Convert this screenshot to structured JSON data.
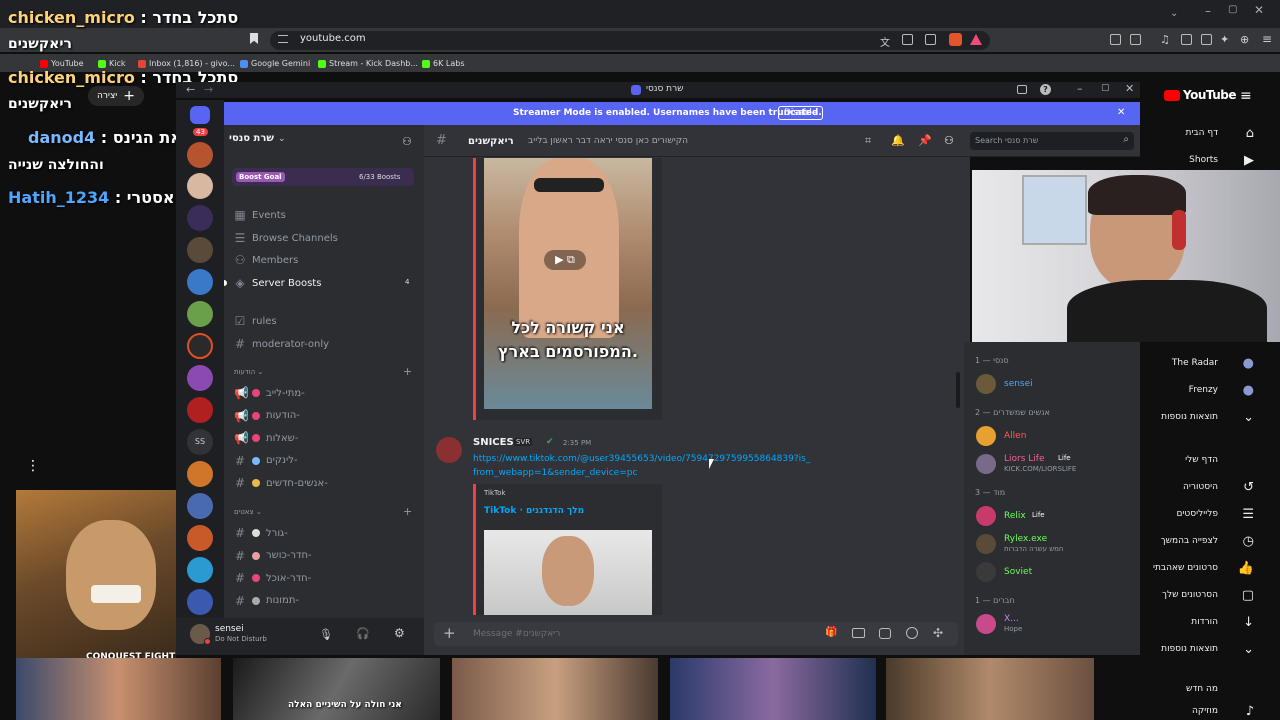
{
  "browser": {
    "url": "youtube.com",
    "bookmarks": [
      "YouTube",
      "Kick",
      "Inbox (1,816) - givo...",
      "Google Gemini",
      "Stream - Kick Dashb...",
      "6K Labs"
    ]
  },
  "chat_overlay": [
    {
      "user": "chicken_micro",
      "sep": " : ",
      "msg": "סתכל בחדר",
      "color": "#ffd27a"
    },
    {
      "user": "",
      "sep": "",
      "msg": "ריאקשנים",
      "color": "#ffffff"
    },
    {
      "user": "chicken_micro",
      "sep": " : ",
      "msg": "סתכל בחדר",
      "color": "#ffd27a"
    },
    {
      "user": "",
      "sep": "",
      "msg": "ריאקשנים",
      "color": "#ffffff"
    },
    {
      "user": "danod4",
      "sep": " : ",
      "msg": "סנסי תראה את הגינס",
      "color": "#7ab8ff"
    },
    {
      "user": "",
      "sep": "",
      "msg": "והחולצה שנייה",
      "color": "#ffffff"
    },
    {
      "user": "Hatih_1234",
      "sep": " : ",
      "msg": "אסטרי",
      "color": "#4ea6ff"
    }
  ],
  "discord": {
    "window_title": "שרת סנסי",
    "notification_count": "43",
    "banner": {
      "text": "Streamer Mode is enabled. Usernames have been truncated.",
      "button": "Disable"
    },
    "server_name": "שרת סנסי",
    "boost": {
      "label": "Boost Goal",
      "progress": "6/33 Boosts"
    },
    "nav": [
      {
        "label": "Events",
        "icon": "calendar-icon"
      },
      {
        "label": "Browse Channels",
        "icon": "list-icon"
      },
      {
        "label": "Members",
        "icon": "members-icon"
      },
      {
        "label": "Server Boosts",
        "icon": "boost-icon",
        "badge": "4"
      }
    ],
    "top_channels": [
      "rules",
      "moderator-only"
    ],
    "category_1": "הודעות",
    "channels_1": [
      "מתי-לייב-",
      "הודעות-",
      "שאלות-",
      "לינקים-",
      "אנשים-חדשים-"
    ],
    "category_2": "צאטים",
    "channels_2": [
      "גורל-",
      "חדר-כושר-",
      "חדר-אוכל-",
      "תמונות-"
    ],
    "user": {
      "name": "sensei",
      "status": "Do Not Disturb"
    },
    "channel_header": {
      "name": "ריאקשנים",
      "topic": "הקישורים כאן סנסי יראה דבר ראשון בלייב",
      "search_placeholder": "Search שרת סנסי"
    },
    "video_caption": "אני קשורה לכל המפורסמים בארץ.",
    "message": {
      "author": "SNICES",
      "tag": "SVR",
      "time": "2:35 PM",
      "link": "https://www.tiktok.com/@user39455653/video/7594729759955864839?is_from_webapp=1&sender_device=pc",
      "embed_provider": "TikTok",
      "embed_title": "TikTok · מלך הדגדגנים"
    },
    "input_placeholder": "Message #ריאקשנים",
    "members": {
      "groups": [
        {
          "title": "סנסי — 1",
          "people": [
            {
              "name": "sensei",
              "color": "#4ea6ff"
            }
          ]
        },
        {
          "title": "אנשים שמשדרים — 2",
          "people": [
            {
              "name": "Allen",
              "color": "#ff5a5a"
            },
            {
              "name": "Liors Life",
              "color": "#ff5a9a",
              "badge": "Life",
              "sub": "KICK.COM/LIORSLIFE"
            }
          ]
        },
        {
          "title": "מוד — 3",
          "people": [
            {
              "name": "Relix",
              "color": "#6bff5a",
              "badge": "Life"
            },
            {
              "name": "Rylex.exe",
              "color": "#6bff5a",
              "sub": "חמש עשרה הדברות"
            },
            {
              "name": "Soviet",
              "color": "#6bff5a"
            }
          ]
        },
        {
          "title": "חברים — 1",
          "people": [
            {
              "name": "X...",
              "color": "#c080ff",
              "sub": "Hope"
            }
          ]
        }
      ]
    }
  },
  "youtube": {
    "logo": "YouTube",
    "sidebar": [
      {
        "label": "דף הבית",
        "icon": "home-icon"
      },
      {
        "label": "Shorts",
        "icon": "shorts-icon"
      },
      {
        "label": "The Radar",
        "icon": "avatar-icon"
      },
      {
        "label": "Frenzy",
        "icon": "avatar-icon"
      },
      {
        "label": "תוצאות נוספות",
        "icon": "chevron-down-icon"
      },
      {
        "label": "הדף שלי",
        "icon": "chevron-right-icon"
      },
      {
        "label": "היסטוריה",
        "icon": "history-icon"
      },
      {
        "label": "פלייליסטים",
        "icon": "playlist-icon"
      },
      {
        "label": "לצפייה בהמשך",
        "icon": "clock-icon"
      },
      {
        "label": "סרטונים שאהבתי",
        "icon": "like-icon"
      },
      {
        "label": "הסרטונים שלך",
        "icon": "video-icon"
      },
      {
        "label": "הורדות",
        "icon": "download-icon"
      },
      {
        "label": "תוצאות נוספות",
        "icon": "chevron-down-icon"
      },
      {
        "label": "מה חדש",
        "icon": ""
      },
      {
        "label": "מוזיקה",
        "icon": "music-icon"
      }
    ],
    "create_label": "יצירה",
    "thumbnail_caption": "אני חולה על השיניים האלה",
    "game_label": "CONQUEST FIGHT"
  }
}
